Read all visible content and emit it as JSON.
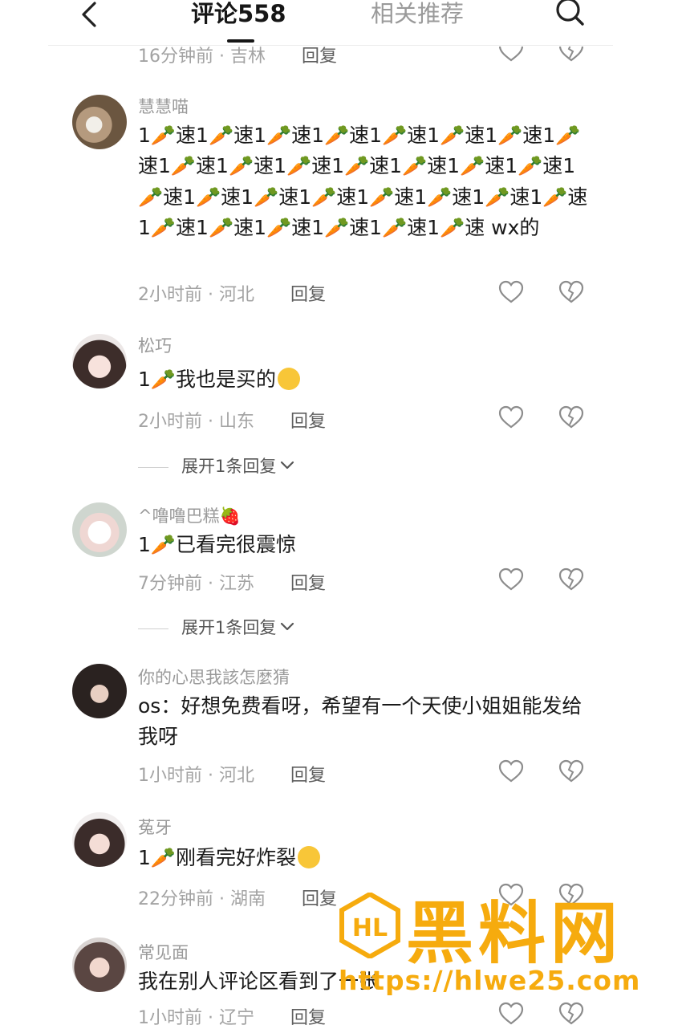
{
  "header": {
    "tab_comments": "评论558",
    "tab_related": "相关推荐"
  },
  "prev_row": {
    "time": "16分钟前",
    "location": "吉林",
    "reply": "回复"
  },
  "comments": [
    {
      "username": "慧慧喵",
      "text": "1🥕速1🥕速1🥕速1🥕速1🥕速1🥕速1🥕速1🥕速1🥕速1🥕速1🥕速1🥕速1🥕速1🥕速1🥕速1🥕速1🥕速1🥕速1🥕速1🥕速1🥕速1🥕速1🥕速1🥕速1🥕速1🥕速1🥕速1🥕速1🥕速 wx的",
      "time": "2小时前",
      "location": "河北",
      "reply": "回复"
    },
    {
      "username": "松巧",
      "text": "1🥕我也是买的",
      "time": "2小时前",
      "location": "山东",
      "reply": "回复",
      "expand": "展开1条回复"
    },
    {
      "username": "^噜噜巴糕🍓",
      "text": "1🥕已看完很震惊",
      "time": "7分钟前",
      "location": "江苏",
      "reply": "回复",
      "expand": "展开1条回复"
    },
    {
      "username": "你的心思我該怎麼猜",
      "text": "os：好想免费看呀，希望有一个天使小姐姐能发给我呀",
      "time": "1小时前",
      "location": "河北",
      "reply": "回复"
    },
    {
      "username": "菟牙",
      "text": "1🥕刚看完好炸裂",
      "time": "22分钟前",
      "location": "湖南",
      "reply": "回复"
    },
    {
      "username": "常见面",
      "text": "我在别人评论区看到了一张",
      "time": "1小时前",
      "location": "辽宁",
      "reply": "回复"
    }
  ],
  "watermark": {
    "brand": "黑料网",
    "url": "https://hlwe25.com"
  },
  "colors": {
    "watermark": "#f6ab0e",
    "meta_text": "#a3a3a3"
  }
}
